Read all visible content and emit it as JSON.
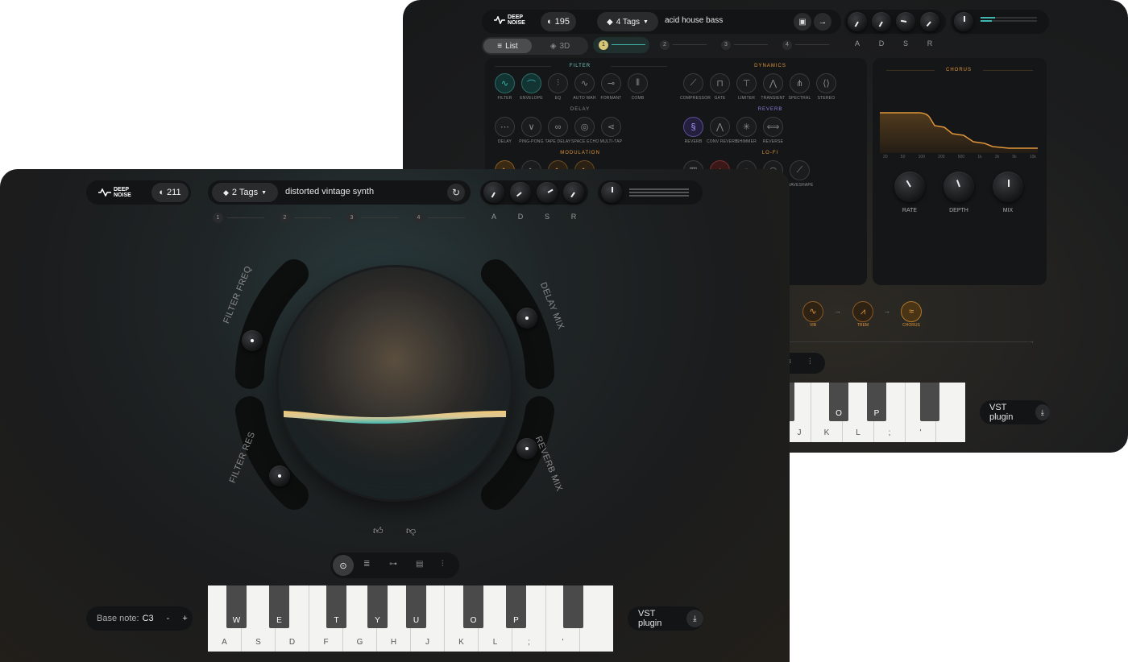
{
  "brand": {
    "logo_line1": "DEEP",
    "logo_line2": "NOISE"
  },
  "back": {
    "count": "195",
    "tags_label": "4 Tags",
    "preset_name": "acid house bass",
    "view_list": "List",
    "view_3d": "3D",
    "steps": [
      "1",
      "2",
      "3",
      "4"
    ],
    "adsr": [
      "A",
      "D",
      "S",
      "R"
    ],
    "sections": {
      "filter": "FILTER",
      "dynamics": "DYNAMICS",
      "delay": "DELAY",
      "reverb": "REVERB",
      "modulation": "MODULATION",
      "lofi": "LO-FI",
      "chorus": "CHORUS"
    },
    "filter_items": [
      "FILTER",
      "ENVELOPE",
      "EQ",
      "AUTO WAH",
      "FORMANT",
      "COMB"
    ],
    "dynamics_items": [
      "COMPRESSOR",
      "GATE",
      "LIMITER",
      "TRANSIENT",
      "SPECTRAL",
      "STEREO"
    ],
    "delay_items": [
      "DELAY",
      "PING-PONG",
      "TAPE DELAY",
      "SPACE ECHO",
      "MULTI-TAP"
    ],
    "reverb_items": [
      "REVERB",
      "CONV REVERB",
      "SHIMMER",
      "REVERSE"
    ],
    "lofi_items": [
      "WAVESHAPE"
    ],
    "chorus_knobs": [
      "RATE",
      "DEPTH",
      "MIX"
    ],
    "chorus_freqs": [
      "20",
      "50",
      "100",
      "200",
      "500",
      "1k",
      "2k",
      "5k",
      "10k"
    ],
    "chain": [
      "VIB",
      "TREM",
      "CHORUS"
    ],
    "piano_keys": [
      "J",
      "K",
      "L",
      ";",
      "'"
    ],
    "piano_black": [
      "O",
      "P"
    ],
    "vst_label": "VST plugin"
  },
  "front": {
    "count": "211",
    "tags_label": "2 Tags",
    "preset_name": "distorted vintage synth",
    "steps": [
      "1",
      "2",
      "3",
      "4"
    ],
    "adsr": [
      "A",
      "D",
      "S",
      "R"
    ],
    "arc_labels": {
      "filter_freq": "FILTER FREQ",
      "filter_res": "FILTER RES",
      "delay_mix": "DELAY MIX",
      "reverb_mix": "REVERB MIX"
    },
    "base_note_label": "Base note:",
    "base_note_value": "C3",
    "minus": "-",
    "plus": "+",
    "white_keys": [
      "A",
      "S",
      "D",
      "F",
      "G",
      "H",
      "J",
      "K",
      "L",
      ";",
      "'",
      ""
    ],
    "black_keys": [
      "W",
      "E",
      "T",
      "Y",
      "U",
      "O",
      "P",
      ""
    ],
    "vst_label": "VST plugin"
  },
  "colors": {
    "accent_teal": "#3fb7b0",
    "accent_orange": "#e0953a",
    "accent_purple": "#8f7be0"
  }
}
